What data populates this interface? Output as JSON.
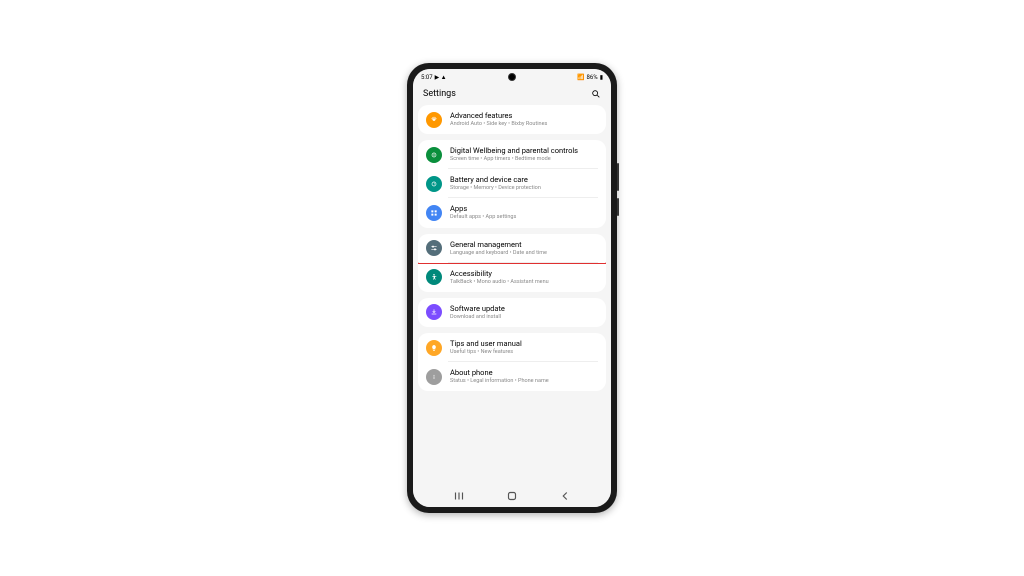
{
  "status": {
    "time": "5:07",
    "indicators": "▶ ▲",
    "signal": "📶",
    "battery_pct": "86%",
    "battery_icon": "▮"
  },
  "header": {
    "title": "Settings"
  },
  "groups": [
    {
      "items": [
        {
          "icon": "gear-icon",
          "color": "ic-orange",
          "title": "Advanced features",
          "sub": "Android Auto • Side key • Bixby Routines",
          "highlight": false
        }
      ]
    },
    {
      "items": [
        {
          "icon": "wellbeing-icon",
          "color": "ic-green",
          "title": "Digital Wellbeing and parental controls",
          "sub": "Screen time • App timers • Bedtime mode",
          "highlight": false
        },
        {
          "icon": "battery-icon",
          "color": "ic-teal",
          "title": "Battery and device care",
          "sub": "Storage • Memory • Device protection",
          "highlight": false
        },
        {
          "icon": "apps-icon",
          "color": "ic-blue",
          "title": "Apps",
          "sub": "Default apps • App settings",
          "highlight": false
        }
      ]
    },
    {
      "items": [
        {
          "icon": "sliders-icon",
          "color": "ic-slate",
          "title": "General management",
          "sub": "Language and keyboard • Date and time",
          "highlight": true
        },
        {
          "icon": "accessibility-icon",
          "color": "ic-teal2",
          "title": "Accessibility",
          "sub": "TalkBack • Mono audio • Assistant menu",
          "highlight": false
        }
      ]
    },
    {
      "items": [
        {
          "icon": "update-icon",
          "color": "ic-purple",
          "title": "Software update",
          "sub": "Download and install",
          "highlight": false
        }
      ]
    },
    {
      "items": [
        {
          "icon": "tips-icon",
          "color": "ic-amber",
          "title": "Tips and user manual",
          "sub": "Useful tips • New features",
          "highlight": false
        },
        {
          "icon": "about-icon",
          "color": "ic-gray",
          "title": "About phone",
          "sub": "Status • Legal information • Phone name",
          "highlight": false
        }
      ]
    }
  ]
}
